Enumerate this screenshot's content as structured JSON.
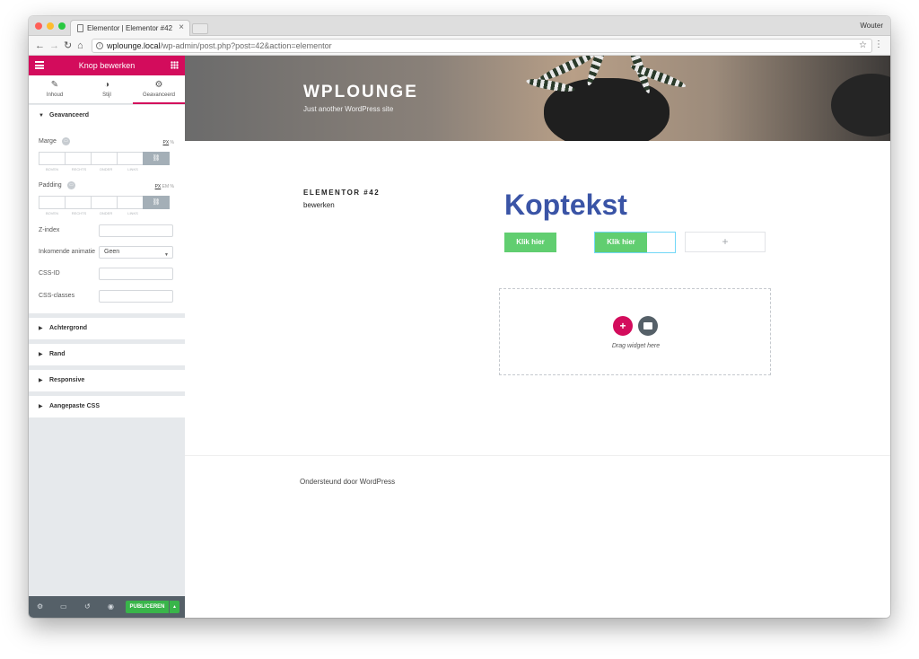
{
  "browser": {
    "tab_title": "Elementor | Elementor #42",
    "user": "Wouter",
    "url_host": "wplounge.local",
    "url_path": "/wp-admin/post.php?post=42&action=elementor"
  },
  "panel": {
    "header_title": "Knop bewerken",
    "tabs": [
      {
        "label": "Inhoud",
        "icon": "pencil-icon"
      },
      {
        "label": "Stijl",
        "icon": "contrast-icon"
      },
      {
        "label": "Geavanceerd",
        "icon": "gear-icon"
      }
    ],
    "advanced_section": "Geavanceerd",
    "margin_label": "Marge",
    "padding_label": "Padding",
    "units": {
      "px": "PX",
      "em": "EM",
      "percent": "%"
    },
    "dimension_labels": [
      "BOVEN",
      "RECHTS",
      "ONDER",
      "LINKS"
    ],
    "zindex_label": "Z-index",
    "animation_label": "Inkomende animatie",
    "animation_value": "Geen",
    "cssid_label": "CSS-ID",
    "cssclasses_label": "CSS-classes",
    "collapsed_sections": [
      "Achtergrond",
      "Rand",
      "Responsive",
      "Aangepaste CSS"
    ],
    "publish_label": "PUBLICEREN"
  },
  "site": {
    "brand": "WPLOUNGE",
    "tagline": "Just another WordPress site",
    "page_title": "ELEMENTOR #42",
    "edit_link": "bewerken",
    "heading": "Koptekst",
    "button1": "Klik hier",
    "button2": "Klik hier",
    "dropzone_text": "Drag widget here",
    "footer": "Ondersteund door WordPress"
  },
  "colors": {
    "accent": "#d30c5c",
    "button": "#61ce70",
    "heading": "#3a54a6",
    "publish": "#39b54a"
  }
}
